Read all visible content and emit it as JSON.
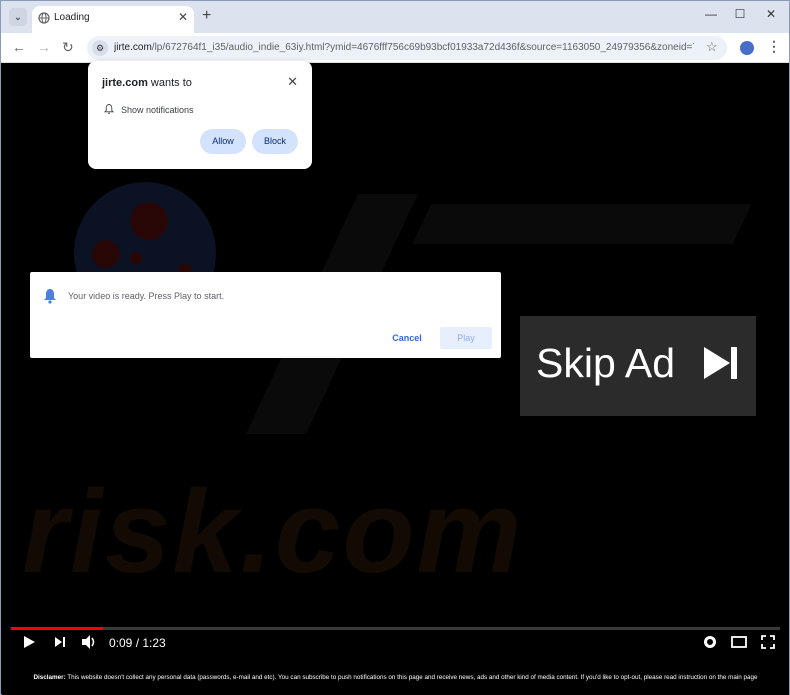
{
  "browser": {
    "tab": {
      "title": "Loading",
      "close_glyph": "✕"
    },
    "tab_search_glyph": "⌄",
    "new_tab_glyph": "+",
    "window_controls": {
      "minimize": "—",
      "maximize": "☐",
      "close": "✕"
    },
    "nav": {
      "back": "←",
      "forward": "→",
      "reload": "↻"
    },
    "url": {
      "host": "jirte.com",
      "path": "/lp/672764f1_i35/audio_indie_63iy.html?ymid=4676fff756c69b93bcf01933a72d436f&source=1163050_24979356&zoneid=7..."
    },
    "bookmark_glyph": "☆",
    "menu_glyph": "⋮"
  },
  "permission_prompt": {
    "site": "jirte.com",
    "title_suffix": " wants to",
    "close_glyph": "✕",
    "permission_text": "Show notifications",
    "allow_label": "Allow",
    "block_label": "Block"
  },
  "dialog": {
    "message": "Your video is ready. Press Play to start.",
    "cancel_label": "Cancel",
    "play_label": "Play"
  },
  "skip_ad": {
    "label": "Skip Ad"
  },
  "player": {
    "current_time": "0:09",
    "separator": " / ",
    "duration": "1:23",
    "progress": 0.12
  },
  "watermark": {
    "text": "risk.com"
  },
  "disclaimer": {
    "label": "Disclamer:",
    "text": " This website doesn't collect any personal data (passwords, e-mail and etc). You can subscribe to push notifications on this page and receive news, ads and other kind of media content. If you'd like to opt-out, please read instruction on the main page"
  }
}
